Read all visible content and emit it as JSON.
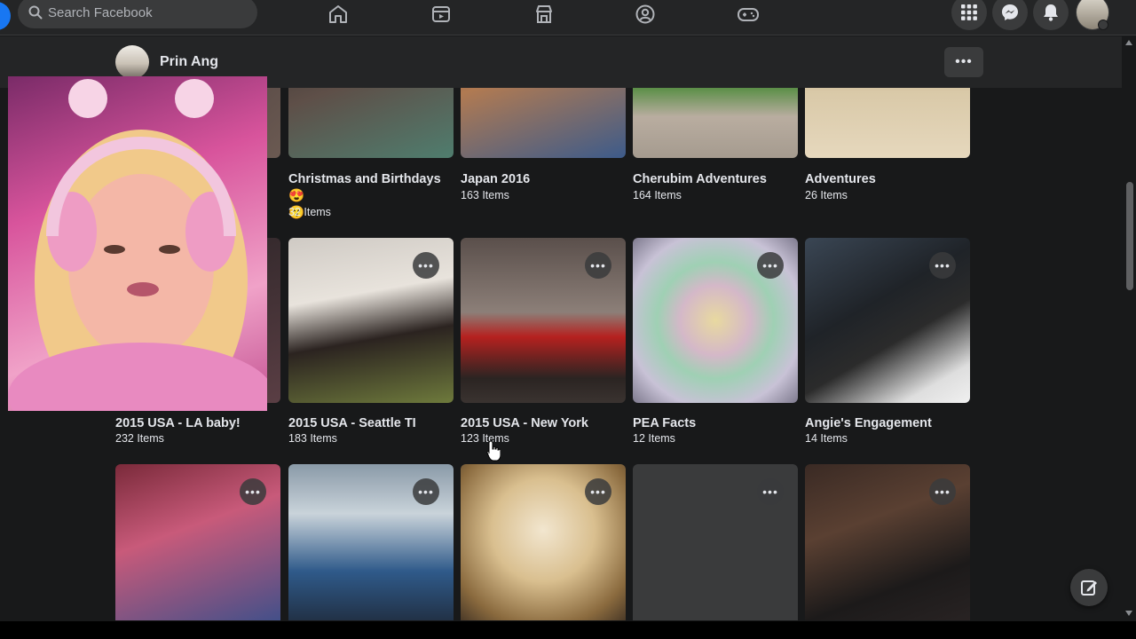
{
  "colors": {
    "page_bg": "#18191a",
    "surface": "#242526",
    "control": "#3a3b3c",
    "text": "#e4e6eb",
    "muted": "#b0b3b8",
    "brand": "#1877f2",
    "alert": "#e41e3f"
  },
  "topbar": {
    "search": {
      "placeholder": "Search Facebook",
      "icon": "search-icon"
    },
    "nav_icons": [
      "home-icon",
      "watch-icon",
      "marketplace-icon",
      "groups-icon",
      "gaming-icon"
    ],
    "right_icons": [
      "menu-grid-icon",
      "messenger-icon",
      "notifications-icon"
    ]
  },
  "profile": {
    "name": "Prin Ang"
  },
  "albums": {
    "row1": [
      {
        "title": "Christmas and Birthdays 😍",
        "title_extra": "😙",
        "count": "32 Items"
      },
      {
        "title": "Japan 2016",
        "count": "163 Items"
      },
      {
        "title": "Cherubim Adventures",
        "count": "164 Items"
      },
      {
        "title": "Adventures",
        "count": "26 Items"
      }
    ],
    "row2": [
      {
        "title": "2015 USA - LA baby!",
        "count": "232 Items"
      },
      {
        "title": "2015 USA - Seattle TI",
        "count": "183 Items"
      },
      {
        "title": "2015 USA - New York",
        "count": "123 Items"
      },
      {
        "title": "PEA Facts",
        "count": "12 Items"
      },
      {
        "title": "Angie's Engagement",
        "count": "14 Items"
      }
    ]
  }
}
